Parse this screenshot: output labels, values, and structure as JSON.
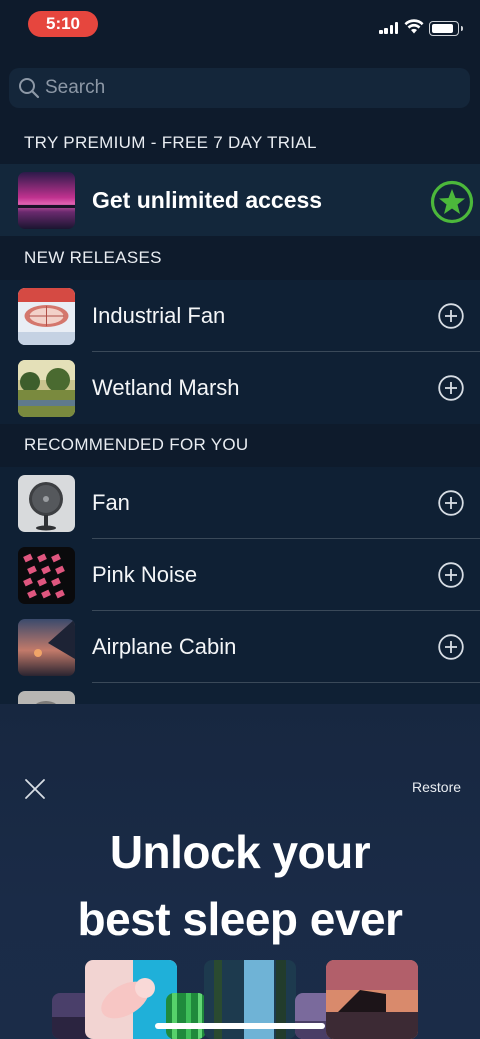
{
  "status_bar": {
    "time": "5:10"
  },
  "search": {
    "placeholder": "Search",
    "icon": "magnifier"
  },
  "premium": {
    "header": "TRY PREMIUM - FREE 7 DAY TRIAL",
    "title": "Get unlimited access",
    "badge_icon": "star-circle"
  },
  "new_releases": {
    "header": "NEW RELEASES",
    "items": [
      {
        "label": "Industrial Fan"
      },
      {
        "label": "Wetland Marsh"
      }
    ]
  },
  "recommended": {
    "header": "RECOMMENDED FOR YOU",
    "items": [
      {
        "label": "Fan"
      },
      {
        "label": "Pink Noise"
      },
      {
        "label": "Airplane Cabin"
      }
    ]
  },
  "paywall": {
    "restore_label": "Restore",
    "headline_line1": "Unlock your",
    "headline_line2": "best sleep ever"
  },
  "colors": {
    "accent_green": "#4cb83b",
    "status_time_bg": "#e6463e",
    "background": "#0e1b2c"
  }
}
